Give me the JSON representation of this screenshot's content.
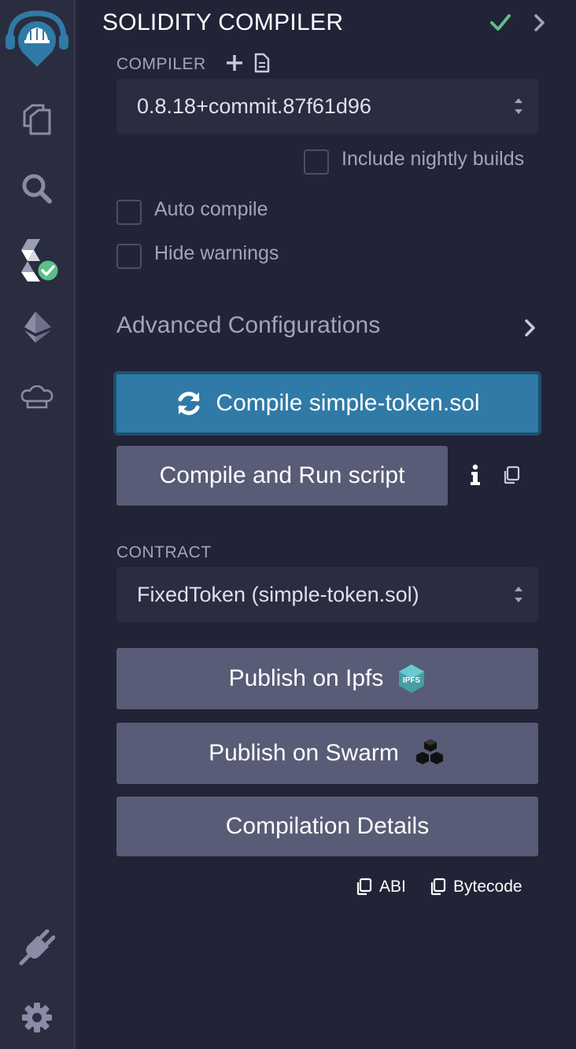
{
  "header": {
    "title": "SOLIDITY COMPILER"
  },
  "compiler": {
    "label": "COMPILER",
    "selected_version": "0.8.18+commit.87f61d96",
    "nightly_label": "Include nightly builds",
    "auto_compile_label": "Auto compile",
    "hide_warnings_label": "Hide warnings"
  },
  "advanced": {
    "title": "Advanced Configurations"
  },
  "actions": {
    "compile_label": "Compile simple-token.sol",
    "run_script_label": "Compile and Run script"
  },
  "contract": {
    "label": "CONTRACT",
    "selected": "FixedToken (simple-token.sol)"
  },
  "publish": {
    "ipfs_label": "Publish on Ipfs",
    "ipfs_badge": "IPFS",
    "swarm_label": "Publish on Swarm"
  },
  "details": {
    "label": "Compilation Details",
    "abi_label": "ABI",
    "bytecode_label": "Bytecode"
  },
  "colors": {
    "accent_blue": "#2f7aa6",
    "success_green": "#5cbf86",
    "button_gray": "#595c76",
    "panel_bg": "#222336",
    "sidebar_bg": "#2a2c3f"
  },
  "sidebar_icons": [
    "remix-logo-icon",
    "file-explorer-icon",
    "search-icon",
    "solidity-compiler-icon",
    "deploy-run-icon",
    "chef-hat-icon",
    "plugin-manager-icon",
    "settings-gear-icon"
  ]
}
